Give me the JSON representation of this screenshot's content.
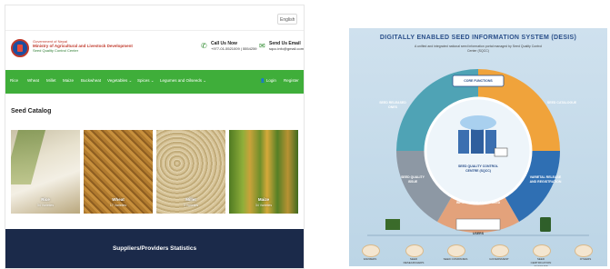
{
  "site": {
    "language": "English",
    "gov": {
      "line1": "Government of Nepal",
      "line2": "Ministry of Agricultural and Livestock Development",
      "line3": "Seed Quality Control Center"
    },
    "call": {
      "title": "Call Us Now",
      "value": "+977-01-5521009 | 5554259",
      "icon": "phone-icon"
    },
    "email": {
      "title": "Send Us Email",
      "value": "sqcc.info@gmail.com",
      "icon": "mail-icon"
    },
    "nav": [
      "Rice",
      "Wheat",
      "Millet",
      "Maize",
      "Buckwheat",
      "Vegetables ⌄",
      "Spices ⌄",
      "Legumes and Oilseeds ⌄"
    ],
    "login": "Login",
    "register": "Register",
    "catalog_title": "Seed Catalog",
    "catalog": [
      {
        "name": "Rice",
        "count": "34 Varieties"
      },
      {
        "name": "Wheat",
        "count": "17 Varieties"
      },
      {
        "name": "Millet",
        "count": "3 Varieties"
      },
      {
        "name": "Maize",
        "count": "34 Varieties"
      }
    ],
    "footer_title": "Suppliers/Providers Statistics",
    "colors": {
      "nav": "#3fae3a",
      "footer": "#1b2a4a"
    }
  },
  "poster": {
    "title": "DIGITALLY ENABLED SEED INFORMATION SYSTEM (DESIS)",
    "subtitle": "A unified and integrated national seed information portal managed by Seed Quality Control Center (SQCC)",
    "center_arc": "DIGITALLY ENABLED SEED INFORMATION SYSTEM (DESIS)",
    "center_label": "SEED QUALITY CONTROL CENTRE (SQCC)",
    "functions": "CORE FUNCTIONS",
    "segments": [
      "SEED RELEASED ONES",
      "SEED CATALOGUE",
      "SEED QUALITY CONTROL",
      "VARIETAL RELEASE AND REGISTRATION",
      "SEED QUALITY ISSUE",
      "INFORMATION ABOUT SEED"
    ],
    "users_label": "USERS",
    "bottom_icons": [
      "FARMERS",
      "SEED RESEARCHERS",
      "SEED COMPANIES",
      "GOVERNMENT",
      "SEED CERTIFICATION AGENCIES",
      "OTHERS"
    ],
    "colors": {
      "navy": "#2a4f8a",
      "teal": "#4fa3b5",
      "orange": "#f0a33b",
      "blue": "#2f6fb3",
      "gray": "#8d98a4",
      "peach": "#e3a27b"
    }
  }
}
